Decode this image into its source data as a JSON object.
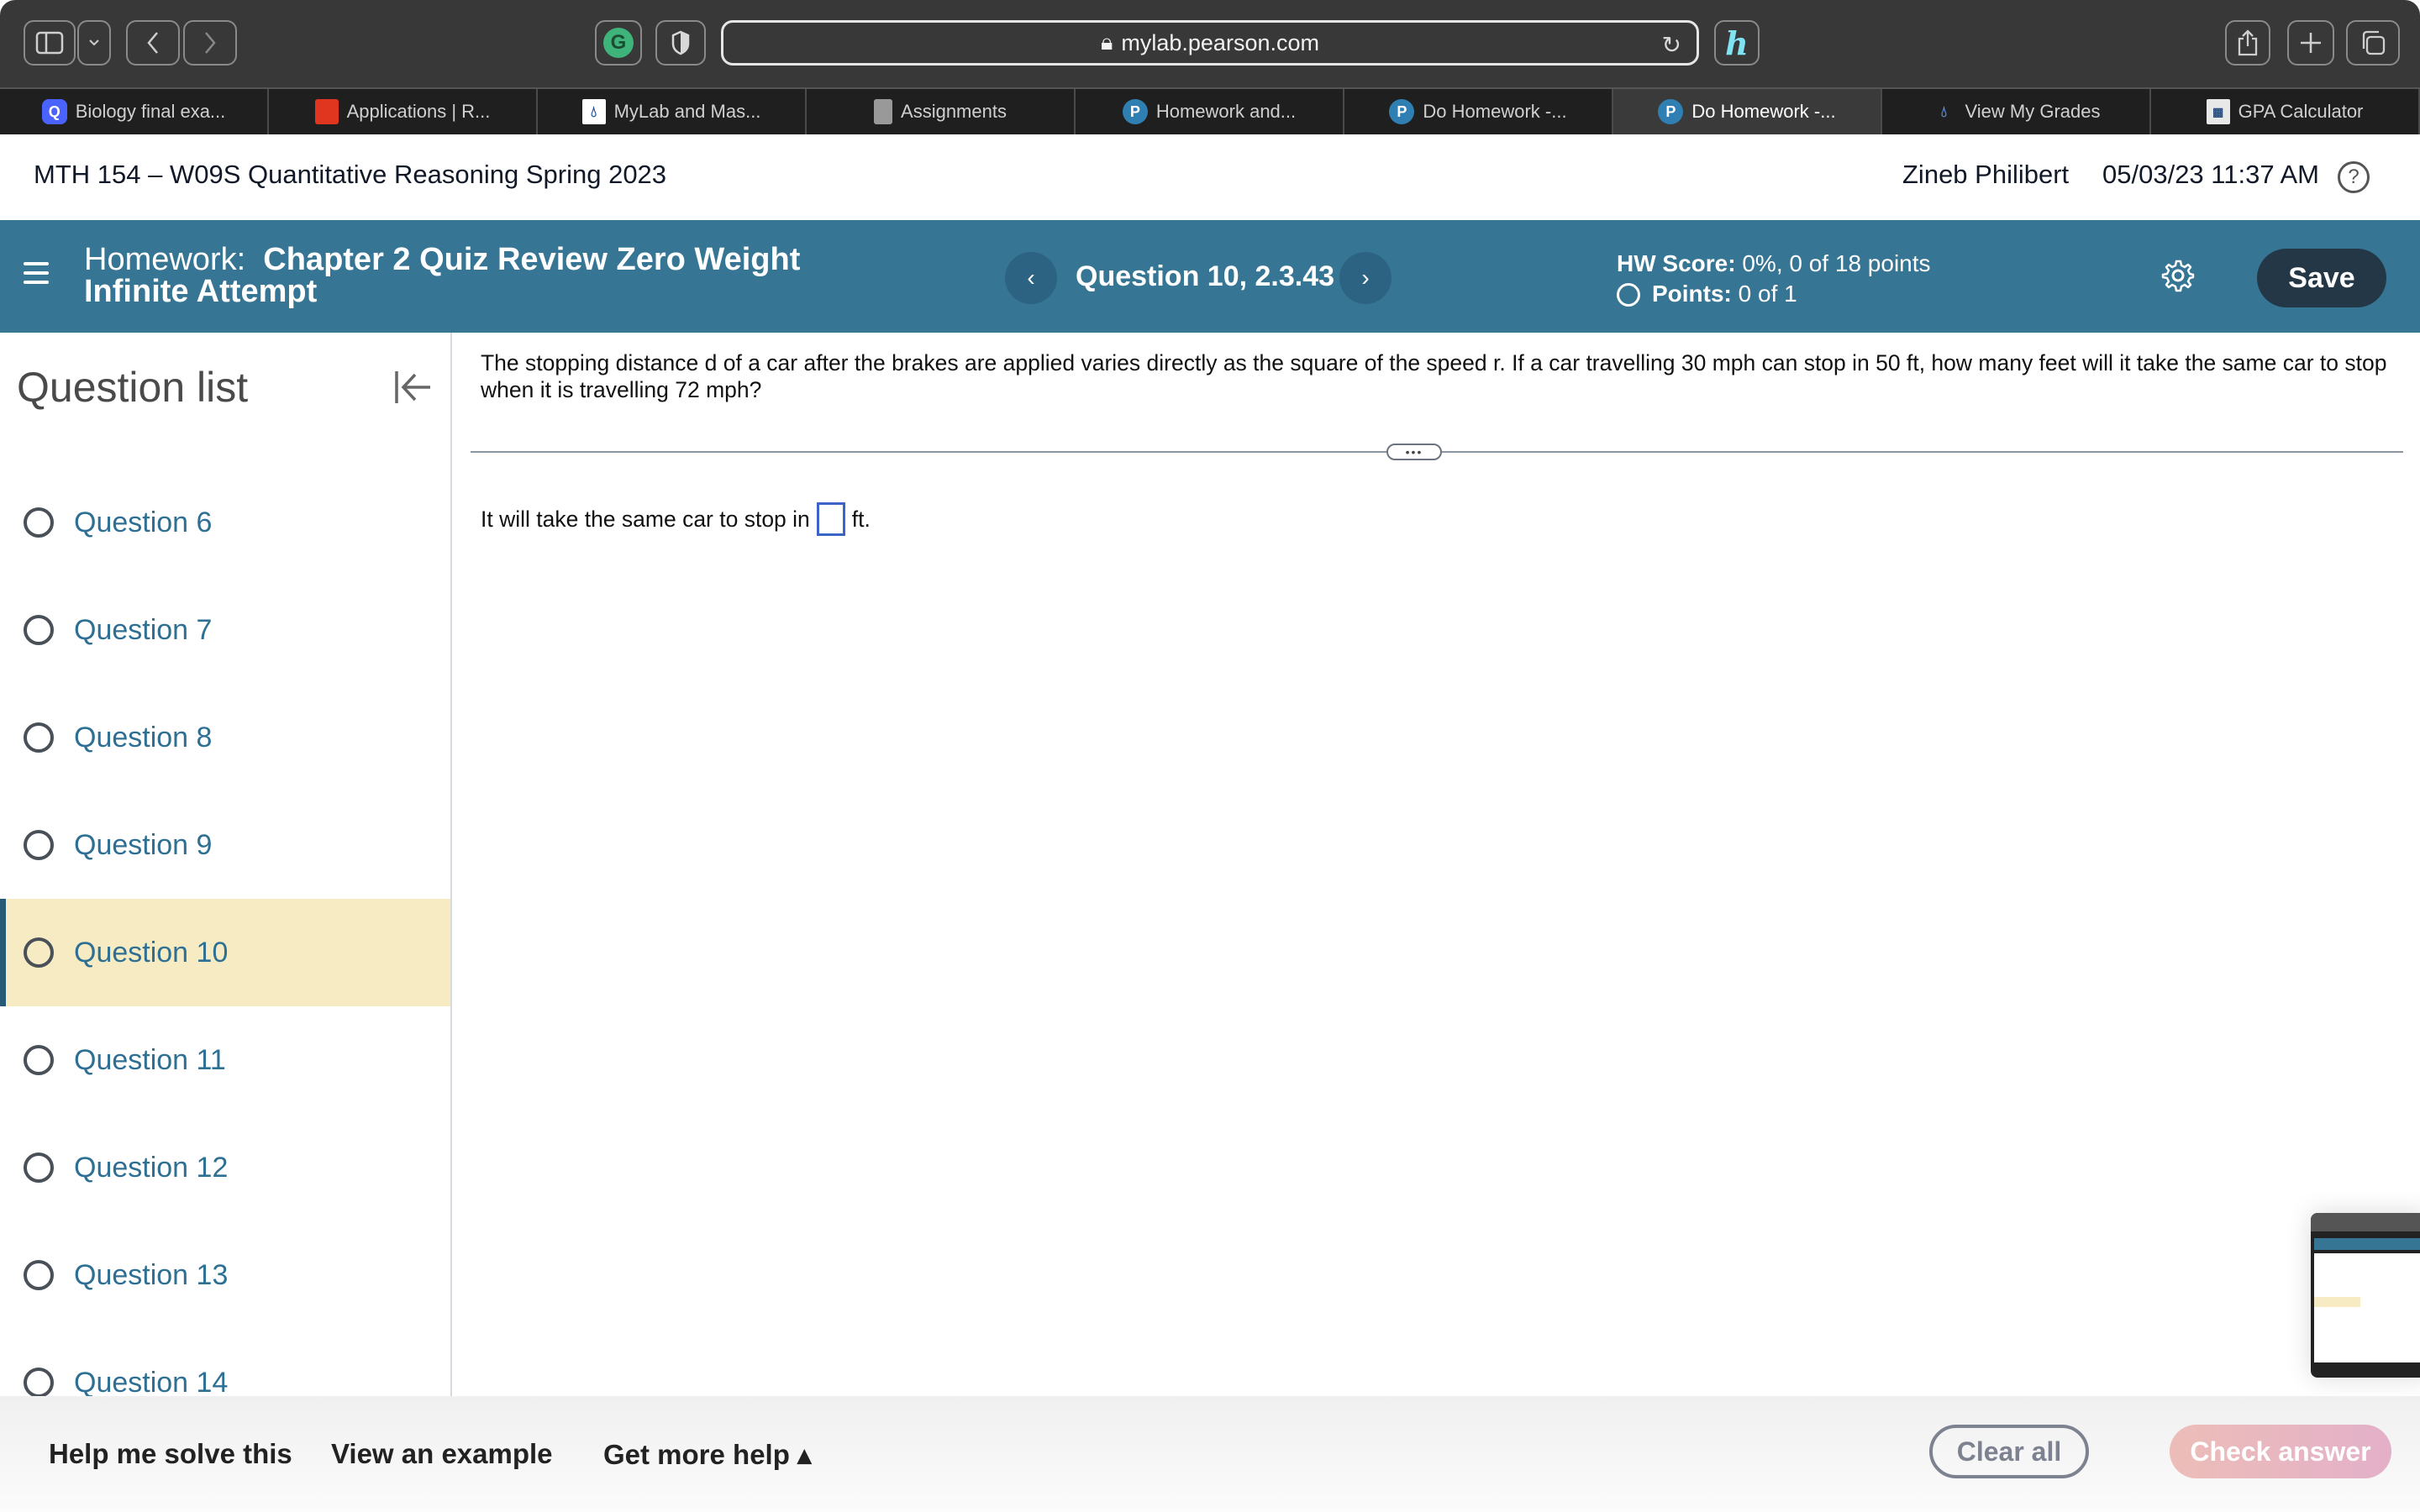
{
  "browser": {
    "url": "mylab.pearson.com",
    "tabs": [
      {
        "label": "Biology final exa...",
        "icon": "quizlet-icon",
        "active": false
      },
      {
        "label": "Applications | R...",
        "icon": "applications-icon",
        "active": false
      },
      {
        "label": "MyLab and Mas...",
        "icon": "mylab-icon",
        "active": false
      },
      {
        "label": "Assignments",
        "icon": "assignments-icon",
        "active": false
      },
      {
        "label": "Homework and...",
        "icon": "pearson-icon",
        "active": false
      },
      {
        "label": "Do Homework -...",
        "icon": "pearson-icon",
        "active": false
      },
      {
        "label": "Do Homework -...",
        "icon": "pearson-icon",
        "active": true
      },
      {
        "label": "View My Grades",
        "icon": "grades-icon",
        "active": false
      },
      {
        "label": "GPA Calculator",
        "icon": "calculator-icon",
        "active": false
      }
    ]
  },
  "header": {
    "course_title": "MTH 154 – W09S Quantitative Reasoning Spring 2023",
    "user_name": "Zineb Philibert",
    "datetime": "05/03/23 11:37 AM",
    "help_glyph": "?"
  },
  "hwbar": {
    "homework_label": "Homework:",
    "homework_name": "Chapter 2 Quiz Review Zero Weight Infinite Attempt",
    "question_label": "Question 10, 2.3.43",
    "prev_glyph": "‹",
    "next_glyph": "›",
    "hw_score_label": "HW Score:",
    "hw_score_value": "0%, 0 of 18 points",
    "points_label": "Points:",
    "points_value": "0 of 1",
    "save_label": "Save"
  },
  "sidebar": {
    "title": "Question list",
    "questions": [
      {
        "label": "Question 6",
        "selected": false
      },
      {
        "label": "Question 7",
        "selected": false
      },
      {
        "label": "Question 8",
        "selected": false
      },
      {
        "label": "Question 9",
        "selected": false
      },
      {
        "label": "Question 10",
        "selected": true
      },
      {
        "label": "Question 11",
        "selected": false
      },
      {
        "label": "Question 12",
        "selected": false
      },
      {
        "label": "Question 13",
        "selected": false
      },
      {
        "label": "Question 14",
        "selected": false
      }
    ]
  },
  "main": {
    "question_text": "The stopping distance d of a car after the brakes are applied varies directly as the square of the speed r. If a car travelling 30 mph can stop in 50 ft, how many feet will it take the same car to stop when it is travelling 72 mph?",
    "divider_handle": "•••",
    "answer_prefix": "It will take the same car to stop in",
    "answer_value": "",
    "answer_suffix": "ft."
  },
  "footer": {
    "help_me_solve": "Help me solve this",
    "view_example": "View an example",
    "get_more_help": "Get more help ▴",
    "clear_all": "Clear all",
    "check_answer": "Check answer"
  },
  "colors": {
    "brand_blue": "#367694",
    "save_button": "#243746",
    "selected_row": "#f7ebc3",
    "selected_accent": "#275a77",
    "question_link": "#2d7093",
    "answer_box_border": "#3a64c6"
  }
}
